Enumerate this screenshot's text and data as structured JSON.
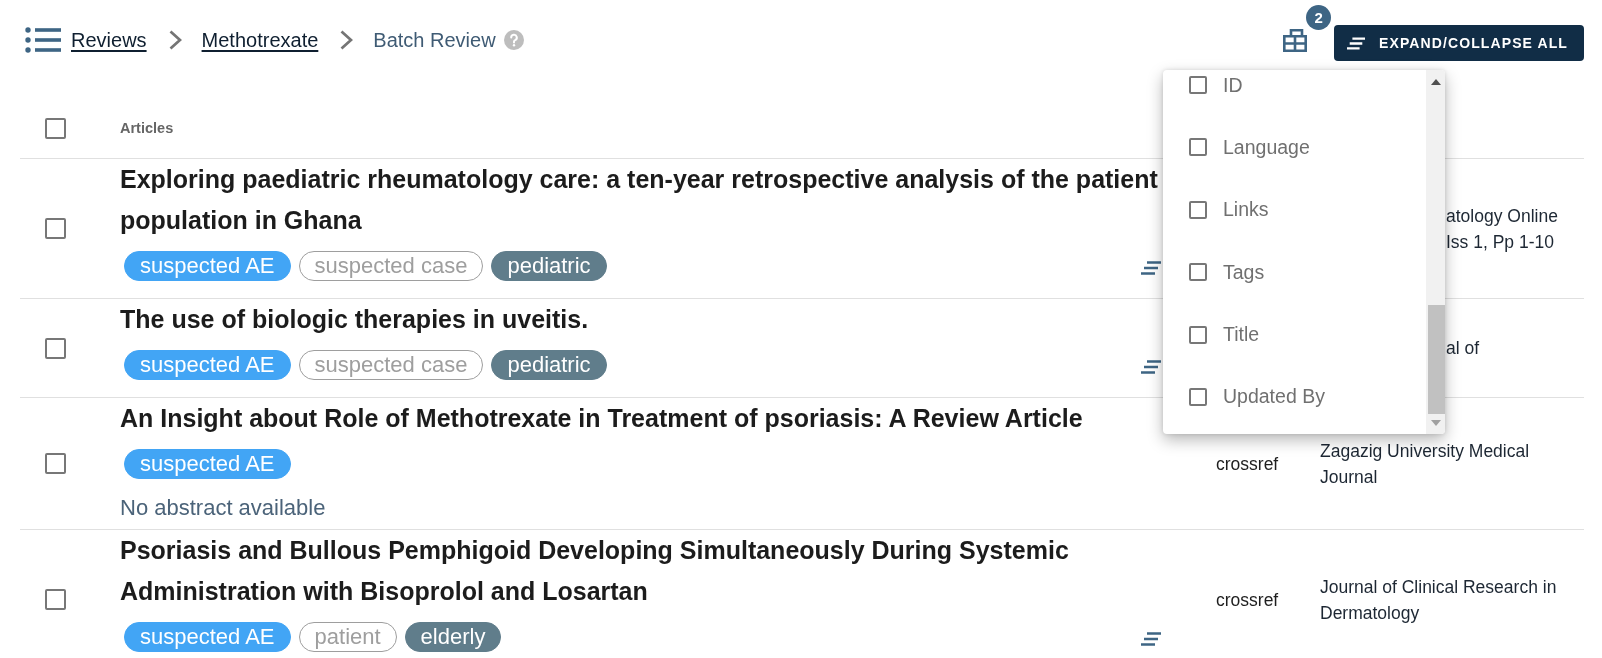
{
  "header": {
    "breadcrumb": [
      {
        "label": "Reviews",
        "kind": "link"
      },
      {
        "label": "Methotrexate",
        "kind": "link"
      },
      {
        "label": "Batch Review",
        "kind": "current"
      }
    ],
    "column_chooser": {
      "badge": "2"
    },
    "expand_button": "EXPAND/COLLAPSE ALL"
  },
  "table": {
    "select_all_checked": false,
    "columns": [
      "Articles"
    ],
    "rows": [
      {
        "selected": false,
        "title": "Exploring paediatric rheumatology care: a ten-year retrospective analysis of the patient population in Ghana",
        "tags": [
          {
            "label": "suspected AE",
            "kind": "filled",
            "color": "#42a5f5"
          },
          {
            "label": "suspected case",
            "kind": "outlined",
            "color": "#9e9e9e"
          },
          {
            "label": "pediatric",
            "kind": "filled",
            "color": "#607d8b"
          }
        ],
        "abstract_toggle": true,
        "journal": "atology Online Iss 1, Pp 1-10",
        "journal_partly_hidden": true
      },
      {
        "selected": false,
        "title": "The use of biologic therapies in uveitis.",
        "tags": [
          {
            "label": "suspected AE",
            "kind": "filled",
            "color": "#42a5f5"
          },
          {
            "label": "suspected case",
            "kind": "outlined",
            "color": "#9e9e9e"
          },
          {
            "label": "pediatric",
            "kind": "filled",
            "color": "#607d8b"
          }
        ],
        "abstract_toggle": true,
        "journal": "al of",
        "journal_partly_hidden": true
      },
      {
        "selected": false,
        "title": "An Insight about Role of Methotrexate in Treatment of psoriasis: A Review Article",
        "tags": [
          {
            "label": "suspected AE",
            "kind": "filled",
            "color": "#42a5f5"
          }
        ],
        "abstract_toggle": false,
        "abstract_note": "No abstract available",
        "source": "crossref",
        "journal": "Zagazig University Medical Journal",
        "journal_partly_hidden": false
      },
      {
        "selected": false,
        "title": "Psoriasis and Bullous Pemphigoid Developing Simultaneously During Systemic Administration with Bisoprolol and Losartan",
        "tags": [
          {
            "label": "suspected AE",
            "kind": "filled",
            "color": "#42a5f5"
          },
          {
            "label": "patient",
            "kind": "outlined",
            "color": "#9e9e9e"
          },
          {
            "label": "elderly",
            "kind": "filled",
            "color": "#607d8b"
          }
        ],
        "abstract_toggle": true,
        "source": "crossref",
        "journal": "Journal of Clinical Research in Dermatology",
        "journal_partly_hidden": false
      }
    ]
  },
  "column_menu": {
    "items": [
      {
        "label": "ID",
        "checked": false
      },
      {
        "label": "Language",
        "checked": false
      },
      {
        "label": "Links",
        "checked": false
      },
      {
        "label": "Tags",
        "checked": false
      },
      {
        "label": "Title",
        "checked": false
      },
      {
        "label": "Updated By",
        "checked": false
      }
    ]
  }
}
